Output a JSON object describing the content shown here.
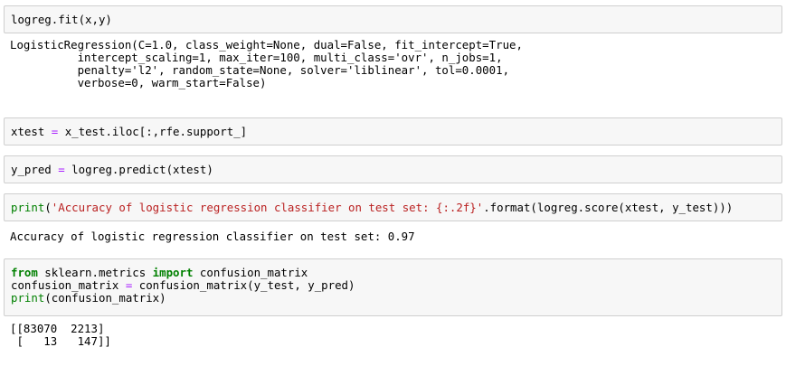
{
  "cells": [
    {
      "id": "cell-fit",
      "source": [
        [
          {
            "t": "logreg.fit(x,y)",
            "c": "tok"
          }
        ]
      ],
      "output": [
        "LogisticRegression(C=1.0, class_weight=None, dual=False, fit_intercept=True,",
        "          intercept_scaling=1, max_iter=100, multi_class='ovr', n_jobs=1,",
        "          penalty='l2', random_state=None, solver='liblinear', tol=0.0001,",
        "          verbose=0, warm_start=False)"
      ]
    },
    {
      "id": "cell-xtest",
      "source": [
        [
          {
            "t": "xtest ",
            "c": "tok"
          },
          {
            "t": "=",
            "c": "op"
          },
          {
            "t": " x_test.iloc[:,rfe.support_]",
            "c": "tok"
          }
        ]
      ],
      "output": []
    },
    {
      "id": "cell-predict",
      "source": [
        [
          {
            "t": "y_pred ",
            "c": "tok"
          },
          {
            "t": "=",
            "c": "op"
          },
          {
            "t": " logreg.predict(xtest)",
            "c": "tok"
          }
        ]
      ],
      "output": []
    },
    {
      "id": "cell-accuracy",
      "source": [
        [
          {
            "t": "print",
            "c": "bi"
          },
          {
            "t": "(",
            "c": "tok"
          },
          {
            "t": "'Accuracy of logistic regression classifier on test set: {:.2f}'",
            "c": "str"
          },
          {
            "t": ".format(logreg.score(xtest, y_test)))",
            "c": "tok"
          }
        ]
      ],
      "output": [
        "Accuracy of logistic regression classifier on test set: 0.97"
      ]
    },
    {
      "id": "cell-confusion",
      "source": [
        [
          {
            "t": "from",
            "c": "kw"
          },
          {
            "t": " sklearn.metrics ",
            "c": "tok"
          },
          {
            "t": "import",
            "c": "kw"
          },
          {
            "t": " confusion_matrix",
            "c": "tok"
          }
        ],
        [
          {
            "t": "confusion_matrix ",
            "c": "tok"
          },
          {
            "t": "=",
            "c": "op"
          },
          {
            "t": " confusion_matrix(y_test, y_pred)",
            "c": "tok"
          }
        ],
        [
          {
            "t": "print",
            "c": "bi"
          },
          {
            "t": "(confusion_matrix)",
            "c": "tok"
          }
        ]
      ],
      "output": [
        "[[83070  2213]",
        " [   13   147]]"
      ]
    }
  ]
}
